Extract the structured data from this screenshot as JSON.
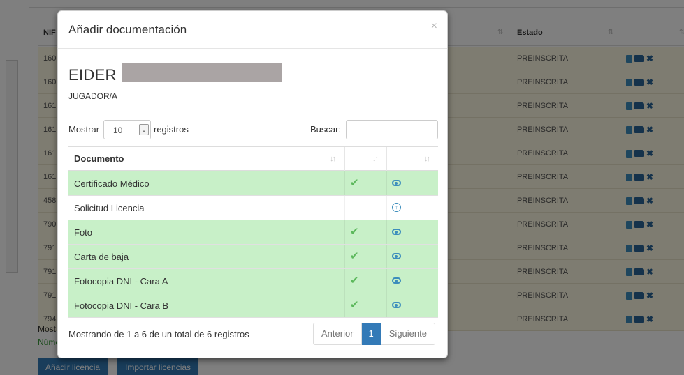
{
  "background": {
    "columns": {
      "nif": "NIF",
      "estado": "Estado"
    },
    "rows": [
      {
        "nif": "160",
        "estado": "PREINSCRITA"
      },
      {
        "nif": "160",
        "estado": "PREINSCRITA"
      },
      {
        "nif": "161",
        "estado": "PREINSCRITA"
      },
      {
        "nif": "161",
        "estado": "PREINSCRITA"
      },
      {
        "nif": "161",
        "estado": "PREINSCRITA"
      },
      {
        "nif": "161",
        "estado": "PREINSCRITA"
      },
      {
        "nif": "458",
        "estado": "PREINSCRITA"
      },
      {
        "nif": "790",
        "estado": "PREINSCRITA"
      },
      {
        "nif": "791",
        "estado": "PREINSCRITA"
      },
      {
        "nif": "791",
        "estado": "PREINSCRITA"
      },
      {
        "nif": "791",
        "estado": "PREINSCRITA"
      },
      {
        "nif": "794",
        "estado": "PREINSCRITA"
      }
    ],
    "footer_line1": "Most",
    "footer_line2": "Núme",
    "buttons": {
      "add_license": "Añadir licencia",
      "import_licenses": "Importar licencias"
    }
  },
  "modal": {
    "title": "Añadir documentación",
    "close_glyph": "×",
    "player": {
      "name": "EIDER",
      "role": "JUGADOR/A"
    },
    "length": {
      "label_before": "Mostrar",
      "value": "10",
      "label_after": "registros"
    },
    "search": {
      "label": "Buscar:",
      "value": ""
    },
    "table": {
      "headers": [
        "Documento",
        "",
        ""
      ],
      "rows": [
        {
          "name": "Certificado Médico",
          "uploaded": true,
          "action": "view"
        },
        {
          "name": "Solicitud Licencia",
          "uploaded": false,
          "action": "upload"
        },
        {
          "name": "Foto",
          "uploaded": true,
          "action": "view"
        },
        {
          "name": "Carta de baja",
          "uploaded": true,
          "action": "view"
        },
        {
          "name": "Fotocopia DNI - Cara A",
          "uploaded": true,
          "action": "view"
        },
        {
          "name": "Fotocopia DNI - Cara B",
          "uploaded": true,
          "action": "view"
        }
      ]
    },
    "info": "Mostrando de 1 a 6 de un total de 6 registros",
    "pagination": {
      "prev": "Anterior",
      "page": "1",
      "next": "Siguiente"
    }
  },
  "colors": {
    "row_ok": "#c8f0c8",
    "row_bg": "#fcf8e3",
    "primary": "#337ab7",
    "check": "#5cb85c"
  }
}
